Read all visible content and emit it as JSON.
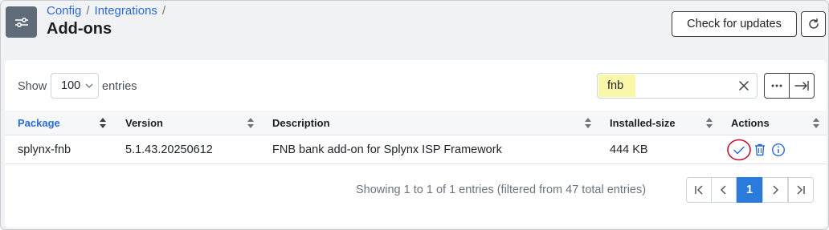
{
  "breadcrumb": {
    "items": [
      "Config",
      "Integrations"
    ],
    "separator": "/"
  },
  "header": {
    "title": "Add-ons",
    "check_updates_label": "Check for updates"
  },
  "table_controls": {
    "show_label": "Show",
    "page_size": "100",
    "entries_label": "entries",
    "search_value": "fnb"
  },
  "table": {
    "columns": [
      "Package",
      "Version",
      "Description",
      "Installed-size",
      "Actions"
    ],
    "rows": [
      {
        "package": "splynx-fnb",
        "version": "5.1.43.20250612",
        "description": "FNB bank add-on for Splynx ISP Framework",
        "installed_size": "444 KB"
      }
    ]
  },
  "pagination": {
    "info": "Showing 1 to 1 of 1 entries (filtered from 47 total entries)",
    "current_page": "1"
  },
  "colors": {
    "accent": "#2a6bd8",
    "page_active": "#2a7bdc",
    "search_highlight": "#fbf7a8",
    "check_circle": "#c8102e"
  }
}
